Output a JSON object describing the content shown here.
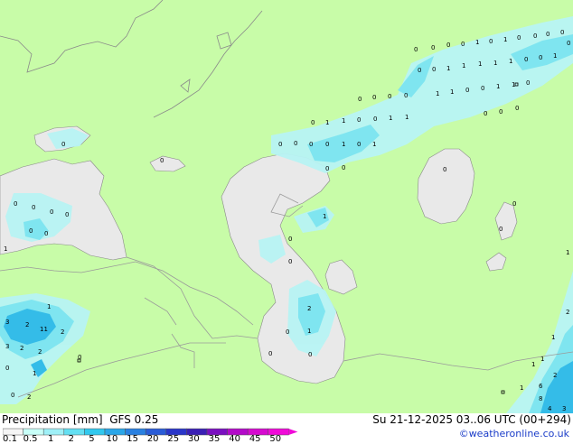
{
  "legend": {
    "title": "Precipitation [mm]",
    "model": "GFS 0.25",
    "run_info": "Su 21-12-2025 03..06 UTC (00+294)",
    "credit": "©weatheronline.co.uk",
    "scale_labels": [
      "0.1",
      "0.5",
      "1",
      "2",
      "5",
      "10",
      "15",
      "20",
      "25",
      "30",
      "35",
      "40",
      "45",
      "50"
    ],
    "scale_colors": [
      "#f5f5f5",
      "#c8fff8",
      "#9ff0f7",
      "#64dff2",
      "#31c8ee",
      "#2ba6e8",
      "#2a80e0",
      "#2a5cd7",
      "#2a36c9",
      "#3a20b5",
      "#7a10c0",
      "#b30ac9",
      "#d60ad0",
      "#f00ad8"
    ]
  },
  "colors": {
    "land": "#c8fca8",
    "water": "#e9e9e9",
    "border": "#9a9a9a",
    "light_precip": "#b8f4f4",
    "moderate_precip": "#7fe5f0",
    "heavy_precip": "#34bce8"
  },
  "map_values": [
    "0",
    "0",
    "0",
    "0",
    "1",
    "0",
    "1",
    "0",
    "0",
    "0",
    "0",
    "0",
    "0",
    "1",
    "1",
    "1",
    "1",
    "1",
    "0",
    "0",
    "1",
    "0",
    "1",
    "1",
    "0",
    "0",
    "1",
    "1",
    "0",
    "0",
    "0",
    "0",
    "0",
    "1",
    "1",
    "0",
    "0",
    "1",
    "1",
    "0",
    "0",
    "0",
    "0",
    "0",
    "0",
    "0",
    "0",
    "1",
    "0",
    "1",
    "0",
    "0",
    "0",
    "0",
    "0",
    "0",
    "0",
    "0",
    "0",
    "0",
    "0",
    "0",
    "0",
    "0",
    "1",
    "1",
    "0",
    "0",
    "0",
    "2",
    "1",
    "0",
    "3",
    "2",
    "2",
    "0",
    "0",
    "11",
    "2",
    "1",
    "3",
    "2",
    "2",
    "1",
    "0",
    "1",
    "1",
    "1",
    "2",
    "1",
    "1",
    "2",
    "4",
    "6",
    "8",
    "3"
  ]
}
